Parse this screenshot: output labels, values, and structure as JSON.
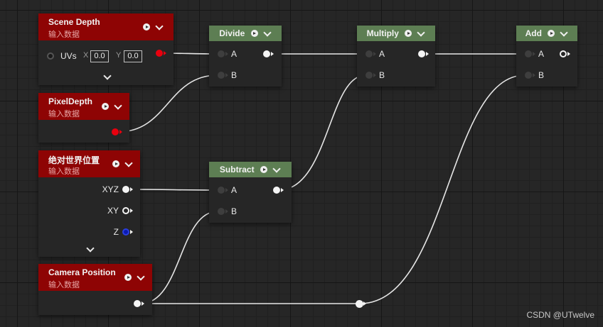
{
  "nodes": {
    "scene_depth": {
      "title": "Scene Depth",
      "subtitle": "输入数据",
      "uv_label": "UVs",
      "x_label": "X",
      "x_value": "0.0",
      "y_label": "Y",
      "y_value": "0.0"
    },
    "pixel_depth": {
      "title": "PixelDepth",
      "subtitle": "输入数据"
    },
    "absolute_world_position": {
      "title": "绝对世界位置",
      "subtitle": "输入数据",
      "outputs": [
        "XYZ",
        "XY",
        "Z"
      ]
    },
    "camera_position": {
      "title": "Camera Position",
      "subtitle": "输入数据"
    },
    "divide": {
      "title": "Divide",
      "input_a": "A",
      "input_b": "B"
    },
    "subtract": {
      "title": "Subtract",
      "input_a": "A",
      "input_b": "B"
    },
    "multiply": {
      "title": "Multiply",
      "input_a": "A",
      "input_b": "B"
    },
    "add": {
      "title": "Add",
      "input_a": "A",
      "input_b": "B"
    }
  },
  "colors": {
    "input_header": "#8e0404",
    "math_header": "#5d7e53",
    "float_pin": "#e8000e",
    "vector_pin": "#f4f4f4",
    "z_pin": "#0a1ab0",
    "wire": "#e8e8e8"
  },
  "watermark": "CSDN @UTwelve"
}
